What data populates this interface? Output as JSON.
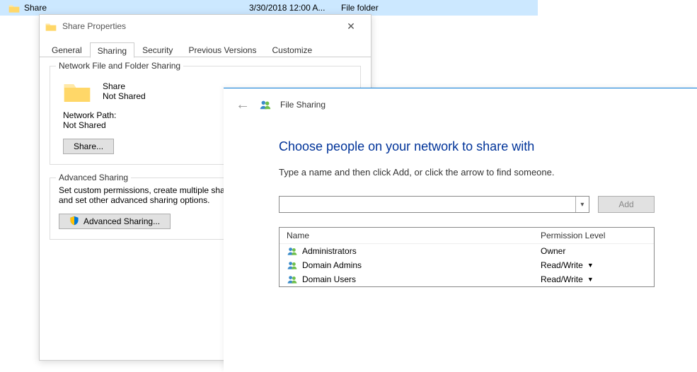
{
  "explorer": {
    "item_name": "Share",
    "item_date": "3/30/2018 12:00 A...",
    "item_type": "File folder"
  },
  "propDialog": {
    "title": "Share Properties",
    "tabs": [
      "General",
      "Sharing",
      "Security",
      "Previous Versions",
      "Customize"
    ],
    "active_tab_index": 1,
    "net_group": {
      "legend": "Network File and Folder Sharing",
      "folder_name": "Share",
      "status": "Not Shared",
      "path_label": "Network Path:",
      "path_value": "Not Shared",
      "share_btn": "Share..."
    },
    "adv_group": {
      "legend": "Advanced Sharing",
      "desc": "Set custom permissions, create multiple shares, and set other advanced sharing options.",
      "adv_btn": "Advanced Sharing..."
    }
  },
  "wizard": {
    "title": "File Sharing",
    "heading": "Choose people on your network to share with",
    "sub": "Type a name and then click Add, or click the arrow to find someone.",
    "add_btn": "Add",
    "cols": {
      "name": "Name",
      "perm": "Permission Level"
    },
    "entries": [
      {
        "name": "Administrators",
        "perm": "Owner",
        "has_dropdown": false
      },
      {
        "name": "Domain Admins",
        "perm": "Read/Write",
        "has_dropdown": true
      },
      {
        "name": "Domain Users",
        "perm": "Read/Write",
        "has_dropdown": true
      }
    ]
  }
}
